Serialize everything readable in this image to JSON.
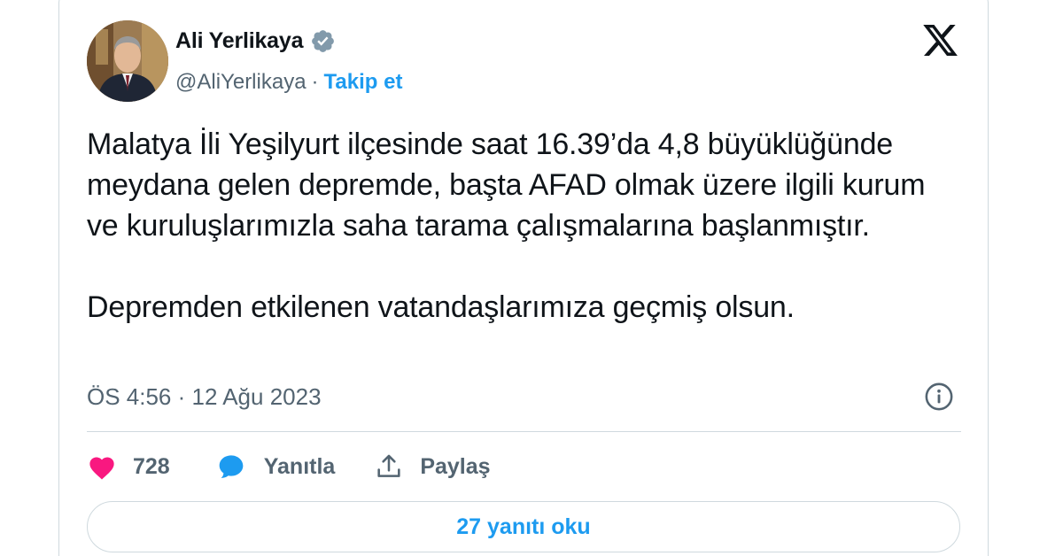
{
  "author": {
    "name": "Ali Yerlikaya",
    "handle": "@AliYerlikaya",
    "separator": "·",
    "follow_label": "Takip et"
  },
  "tweet": {
    "paragraphs": [
      "Malatya İli Yeşilyurt ilçesinde saat 16.39’da 4,8 büyüklüğünde meydana gelen depremde, başta AFAD olmak üzere ilgili kurum ve kuruluşlarımızla saha tarama çalışmalarına başlanmıştır.",
      "Depremden etkilenen vatandaşlarımıza geçmiş olsun."
    ],
    "timestamp": "ÖS 4:56 · 12 Ağu 2023"
  },
  "actions": {
    "like_count": "728",
    "reply_label": "Yanıtla",
    "share_label": "Paylaş"
  },
  "read_replies_label": "27 yanıtı oku",
  "icons": {
    "verified": "verified-badge-icon",
    "platform": "x-logo-icon",
    "info": "info-icon",
    "like": "heart-icon",
    "reply": "speech-bubble-icon",
    "share": "share-upload-icon"
  },
  "colors": {
    "accent": "#1d9bf0",
    "like": "#f91880",
    "secondary_text": "#536471",
    "border": "#cfd9de",
    "verified_badge": "#829aab"
  }
}
